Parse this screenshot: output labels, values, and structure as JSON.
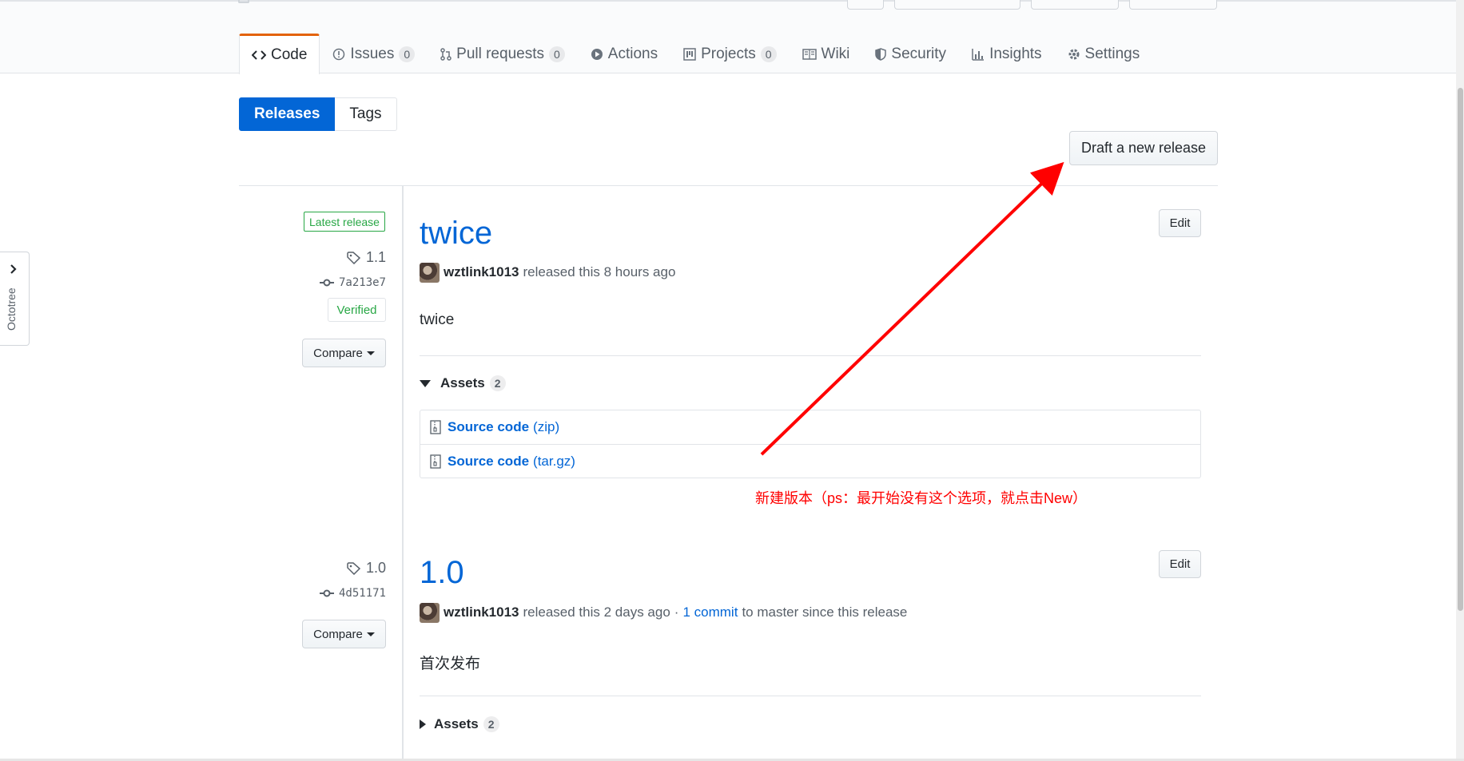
{
  "tabs": [
    {
      "label": "Code",
      "icon": "code-icon",
      "counter": null,
      "selected": true
    },
    {
      "label": "Issues",
      "icon": "issue-opened-icon",
      "counter": "0",
      "selected": false
    },
    {
      "label": "Pull requests",
      "icon": "git-pull-request-icon",
      "counter": "0",
      "selected": false
    },
    {
      "label": "Actions",
      "icon": "play-icon",
      "counter": null,
      "selected": false
    },
    {
      "label": "Projects",
      "icon": "project-icon",
      "counter": "0",
      "selected": false
    },
    {
      "label": "Wiki",
      "icon": "book-icon",
      "counter": null,
      "selected": false
    },
    {
      "label": "Security",
      "icon": "shield-icon",
      "counter": null,
      "selected": false
    },
    {
      "label": "Insights",
      "icon": "graph-icon",
      "counter": null,
      "selected": false
    },
    {
      "label": "Settings",
      "icon": "gear-icon",
      "counter": null,
      "selected": false
    }
  ],
  "subnav": {
    "releases": "Releases",
    "tags": "Tags"
  },
  "draft_button": "Draft a new release",
  "releases": [
    {
      "latest_label": "Latest release",
      "tag": "1.1",
      "commit": "7a213e7",
      "verified": "Verified",
      "compare": "Compare",
      "title": "twice",
      "edit": "Edit",
      "author": "wztlink1013",
      "released_text": "released this 8 hours ago",
      "description": "twice",
      "assets_label": "Assets",
      "assets_count": "2",
      "assets": [
        {
          "name": "Source code",
          "format": "(zip)"
        },
        {
          "name": "Source code",
          "format": "(tar.gz)"
        }
      ]
    },
    {
      "tag": "1.0",
      "commit": "4d51171",
      "compare": "Compare",
      "title": "1.0",
      "edit": "Edit",
      "author": "wztlink1013",
      "released_text": "released this 2 days ago",
      "separator": "·",
      "commits_link": "1 commit",
      "commits_suffix": "to master since this release",
      "description": "首次发布",
      "assets_label": "Assets",
      "assets_count": "2"
    }
  ],
  "annotation": "新建版本（ps：最开始没有这个选项，就点击New）",
  "octotree_label": "Octotree",
  "colors": {
    "accent": "#0366d6",
    "tab_highlight": "#e36209",
    "verified": "#28a745",
    "annotation": "#ff0000"
  }
}
